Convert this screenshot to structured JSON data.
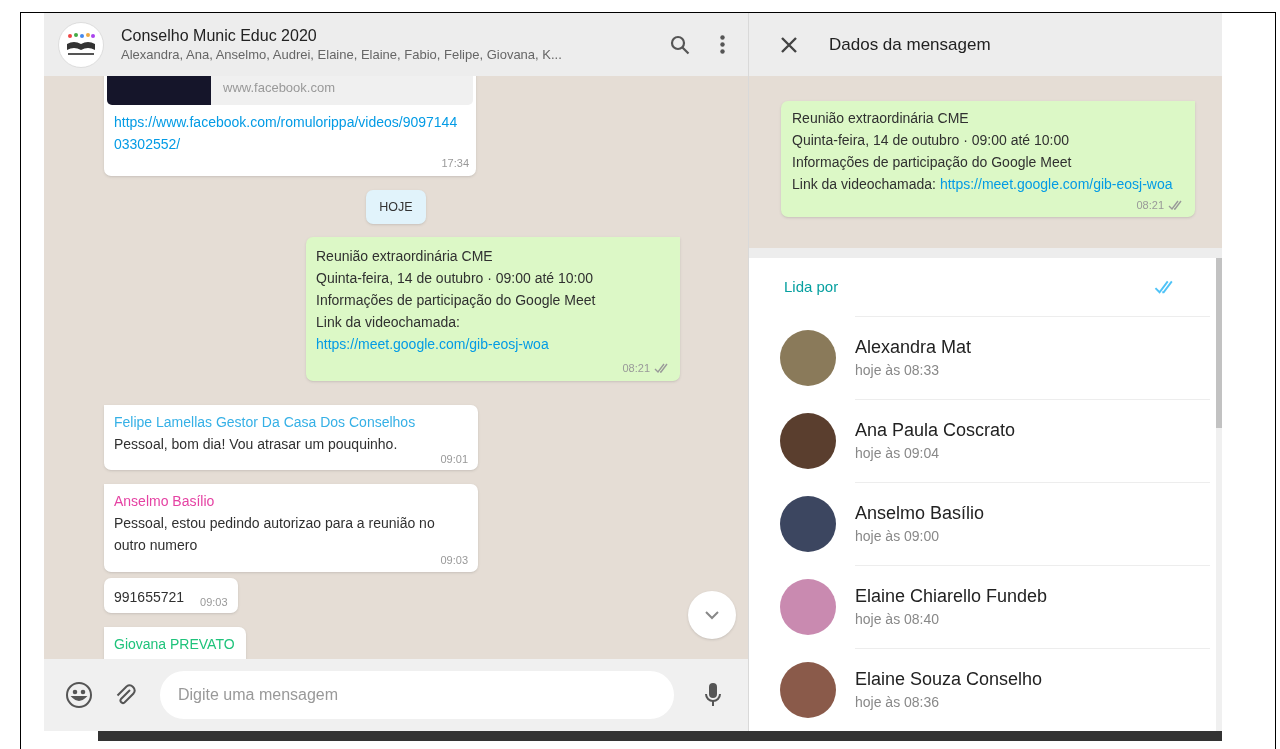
{
  "chat": {
    "title": "Conselho Munic Educ 2020",
    "participants": "Alexandra, Ana, Anselmo, Audrei, Elaine, Elaine, Fabio, Felipe, Giovana, K...",
    "messages": [
      {
        "kind": "link_preview",
        "domain": "www.facebook.com",
        "link": "https://www.facebook.com/romulorippa/videos/909714403302552/",
        "time": "17:34"
      },
      {
        "kind": "date",
        "text": "HOJE"
      },
      {
        "kind": "outgoing",
        "lines": [
          "Reunião extraordinária CME",
          "Quinta-feira, 14 de outubro · 09:00 até 10:00",
          "Informações de participação do Google Meet",
          "Link da videochamada:"
        ],
        "link": "https://meet.google.com/gib-eosj-woa",
        "time": "08:21",
        "read": true
      },
      {
        "kind": "incoming",
        "sender": "Felipe Lamellas Gestor Da Casa Dos Conselhos",
        "color": "#35b0e6",
        "text": "Pessoal, bom dia! Vou atrasar um pouquinho.",
        "time": "09:01"
      },
      {
        "kind": "incoming",
        "sender": "Anselmo Basílio",
        "color": "#e542a3",
        "text": "Pessoal, estou pedindo autorizao para a reunião no outro numero",
        "time": "09:03"
      },
      {
        "kind": "incoming",
        "text": "991655721",
        "time": "09:03"
      },
      {
        "kind": "incoming",
        "sender": "Giovana PREVATO",
        "color": "#1fc37b"
      }
    ],
    "composer": {
      "placeholder": "Digite uma mensagem"
    }
  },
  "details": {
    "title": "Dados da mensagem",
    "message": {
      "lines": [
        "Reunião extraordinária CME",
        "Quinta-feira, 14 de outubro · 09:00 até 10:00",
        "Informações de participação do Google Meet",
        "Link da videochamada: "
      ],
      "link": "https://meet.google.com/gib-eosj-woa",
      "time": "08:21",
      "read": true
    },
    "read_by": {
      "label": "Lida por",
      "entries": [
        {
          "name": "Alexandra Mat",
          "time": "hoje às 08:33"
        },
        {
          "name": "Ana Paula Coscrato",
          "time": "hoje às 09:04"
        },
        {
          "name": "Anselmo Basílio",
          "time": "hoje às 09:00"
        },
        {
          "name": "Elaine Chiarello Fundeb",
          "time": "hoje às 08:40"
        },
        {
          "name": "Elaine Souza Conselho",
          "time": "hoje às 08:36"
        }
      ]
    }
  }
}
